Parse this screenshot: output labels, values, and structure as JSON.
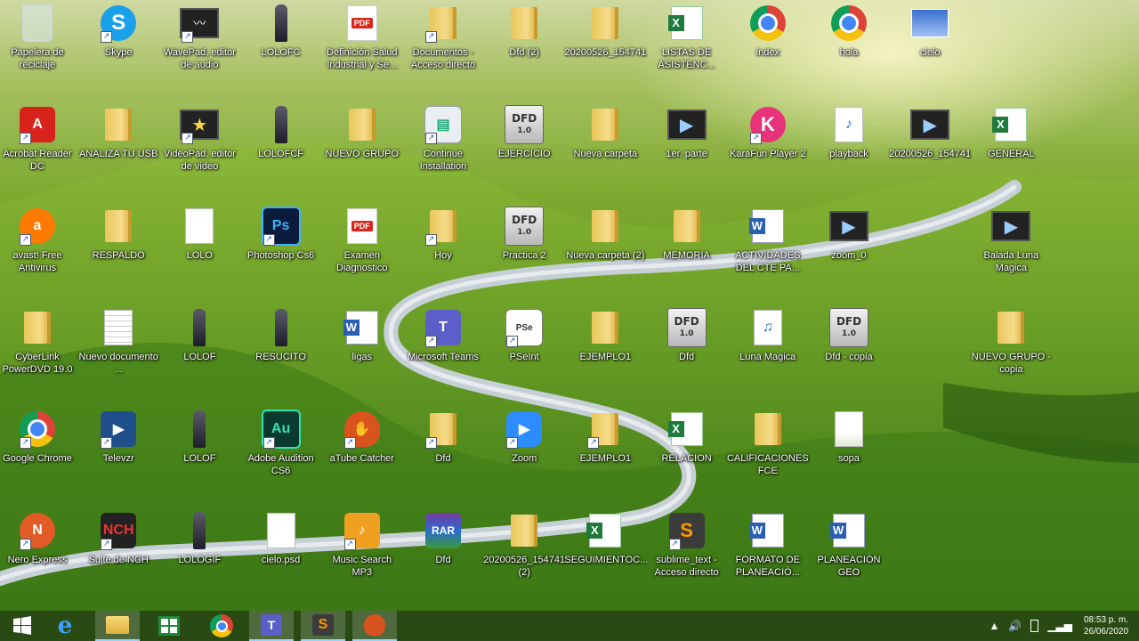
{
  "desktop": {
    "icons": [
      {
        "label": "Papelera de reciclaje",
        "icon": "recycle-bin-icon",
        "shortcut": false
      },
      {
        "label": "Skype",
        "icon": "skype-icon",
        "shortcut": true
      },
      {
        "label": "WavePad, editor de audio",
        "icon": "wavepad-icon",
        "shortcut": true
      },
      {
        "label": "LOLOFC",
        "icon": "person-image-icon",
        "shortcut": false
      },
      {
        "label": "Definición Salud Industrial y Se...",
        "icon": "pdf-icon",
        "shortcut": false
      },
      {
        "label": "Documentos - Acceso directo",
        "icon": "folder-icon",
        "shortcut": true
      },
      {
        "label": "Dfd (2)",
        "icon": "folder-icon",
        "shortcut": false
      },
      {
        "label": "20200526_154741",
        "icon": "folder-icon",
        "shortcut": false
      },
      {
        "label": "LISTAS DE ASISTENC...",
        "icon": "excel-icon",
        "shortcut": false
      },
      {
        "label": "index",
        "icon": "chrome-icon",
        "shortcut": false
      },
      {
        "label": "hola",
        "icon": "chrome-icon",
        "shortcut": false
      },
      {
        "label": "cielo",
        "icon": "sky-image-icon",
        "shortcut": false
      },
      {
        "label": "Acrobat Reader DC",
        "icon": "acrobat-icon",
        "shortcut": true
      },
      {
        "label": "ANALIZA TU USB",
        "icon": "folder-icon",
        "shortcut": false
      },
      {
        "label": "VideoPad, editor de video",
        "icon": "videopad-icon",
        "shortcut": true
      },
      {
        "label": "LOLOFCF",
        "icon": "person-image-icon",
        "shortcut": false
      },
      {
        "label": "NUEVO GRUPO",
        "icon": "folder-icon",
        "shortcut": false
      },
      {
        "label": "Continue Installation",
        "icon": "installer-icon",
        "shortcut": true
      },
      {
        "label": "EJERCICIO",
        "icon": "dfd-icon",
        "shortcut": false
      },
      {
        "label": "Nueva carpeta",
        "icon": "folder-icon",
        "shortcut": false
      },
      {
        "label": "1er. parte",
        "icon": "video-file-icon",
        "shortcut": false
      },
      {
        "label": "KaraFun Player 2",
        "icon": "karafun-icon",
        "shortcut": true
      },
      {
        "label": "playback",
        "icon": "audio-file-icon",
        "shortcut": false
      },
      {
        "label": "20200526_154741",
        "icon": "video-file-icon",
        "shortcut": false
      },
      {
        "label": "GENERAL",
        "icon": "excel-icon",
        "shortcut": false
      },
      {
        "label": "avast! Free Antivirus",
        "icon": "avast-icon",
        "shortcut": true
      },
      {
        "label": "RESPALDO",
        "icon": "folder-icon",
        "shortcut": false
      },
      {
        "label": "LOLO",
        "icon": "blank-file-icon",
        "shortcut": false
      },
      {
        "label": "Photoshop Cs6",
        "icon": "photoshop-icon",
        "shortcut": true
      },
      {
        "label": "Examen Diagnostico",
        "icon": "pdf-icon",
        "shortcut": false
      },
      {
        "label": "Hoy",
        "icon": "folder-icon",
        "shortcut": true
      },
      {
        "label": "Practica 2",
        "icon": "dfd-icon",
        "shortcut": false
      },
      {
        "label": "Nueva carpeta (2)",
        "icon": "folder-icon",
        "shortcut": false
      },
      {
        "label": "MEMORIA",
        "icon": "folder-icon",
        "shortcut": false
      },
      {
        "label": "ACTIVIDADES DEL CTE PA...",
        "icon": "word-icon",
        "shortcut": false
      },
      {
        "label": "zoom_0",
        "icon": "video-file-icon",
        "shortcut": false
      },
      {
        "label": "Balada Luna Magica",
        "icon": "video-file-icon",
        "shortcut": false
      },
      {
        "label": "CyberLink PowerDVD 19.0",
        "icon": "folder-icon",
        "shortcut": false
      },
      {
        "label": "Nuevo documento ...",
        "icon": "text-file-icon",
        "shortcut": false
      },
      {
        "label": "LOLOF",
        "icon": "person-image-icon",
        "shortcut": false
      },
      {
        "label": "RESUCITO",
        "icon": "person-image-icon",
        "shortcut": false
      },
      {
        "label": "ligas",
        "icon": "word-icon",
        "shortcut": false
      },
      {
        "label": "Microsoft Teams",
        "icon": "teams-icon",
        "shortcut": true
      },
      {
        "label": "PSeInt",
        "icon": "pseint-icon",
        "shortcut": true
      },
      {
        "label": "EJEMPLO1",
        "icon": "folder-icon",
        "shortcut": false
      },
      {
        "label": "Dfd",
        "icon": "dfd-icon",
        "shortcut": false
      },
      {
        "label": "Luna Magica",
        "icon": "mp3-icon",
        "shortcut": false
      },
      {
        "label": "Dfd - copia",
        "icon": "dfd-icon",
        "shortcut": false
      },
      {
        "label": "NUEVO GRUPO - copia",
        "icon": "folder-icon",
        "shortcut": false
      },
      {
        "label": "Google Chrome",
        "icon": "chrome-icon",
        "shortcut": true
      },
      {
        "label": "Televzr",
        "icon": "televzr-icon",
        "shortcut": true
      },
      {
        "label": "LOLOF",
        "icon": "person-image-icon",
        "shortcut": false
      },
      {
        "label": "Adobe Audition CS6",
        "icon": "audition-icon",
        "shortcut": true
      },
      {
        "label": "aTube Catcher",
        "icon": "atube-icon",
        "shortcut": true
      },
      {
        "label": "Dfd",
        "icon": "folder-icon",
        "shortcut": true
      },
      {
        "label": "Zoom",
        "icon": "zoom-icon",
        "shortcut": true
      },
      {
        "label": "EJEMPLO1",
        "icon": "folder-icon",
        "shortcut": true
      },
      {
        "label": "RELACION",
        "icon": "excel-icon",
        "shortcut": false
      },
      {
        "label": "CALIFICACIONES FCE",
        "icon": "folder-icon",
        "shortcut": false
      },
      {
        "label": "sopa",
        "icon": "image-file-icon",
        "shortcut": false
      },
      {
        "label": "Nero Express",
        "icon": "nero-icon",
        "shortcut": true
      },
      {
        "label": "Suite de NCH",
        "icon": "nch-icon",
        "shortcut": true
      },
      {
        "label": "LOLOGIF",
        "icon": "person-image-icon",
        "shortcut": false
      },
      {
        "label": "cielo.psd",
        "icon": "blank-file-icon",
        "shortcut": false
      },
      {
        "label": "Music Search MP3",
        "icon": "music-search-icon",
        "shortcut": true
      },
      {
        "label": "Dfd",
        "icon": "winrar-icon",
        "shortcut": false
      },
      {
        "label": "20200526_154741 (2)",
        "icon": "folder-icon",
        "shortcut": false
      },
      {
        "label": "SEGUIMIENTOC...",
        "icon": "excel-icon",
        "shortcut": false
      },
      {
        "label": "sublime_text - Acceso directo",
        "icon": "sublime-icon",
        "shortcut": true
      },
      {
        "label": "FORMATO DE PLANEACIÓ...",
        "icon": "word-icon",
        "shortcut": false
      },
      {
        "label": "PLANEACIÓN GEO",
        "icon": "word-icon",
        "shortcut": false
      }
    ]
  },
  "taskbar": {
    "items": [
      {
        "name": "start-button",
        "icon": "windows-logo-icon"
      },
      {
        "name": "internet-explorer-button",
        "icon": "internet-explorer-icon"
      },
      {
        "name": "file-explorer-button",
        "icon": "file-explorer-icon"
      },
      {
        "name": "store-button",
        "icon": "store-icon"
      },
      {
        "name": "chrome-taskbar-button",
        "icon": "chrome-icon"
      },
      {
        "name": "teams-taskbar-button",
        "icon": "teams-icon"
      },
      {
        "name": "sublime-taskbar-button",
        "icon": "sublime-icon"
      },
      {
        "name": "atube-taskbar-button",
        "icon": "atube-icon"
      }
    ],
    "clock": {
      "time": "08:53 p. m.",
      "date": "26/06/2020"
    }
  }
}
